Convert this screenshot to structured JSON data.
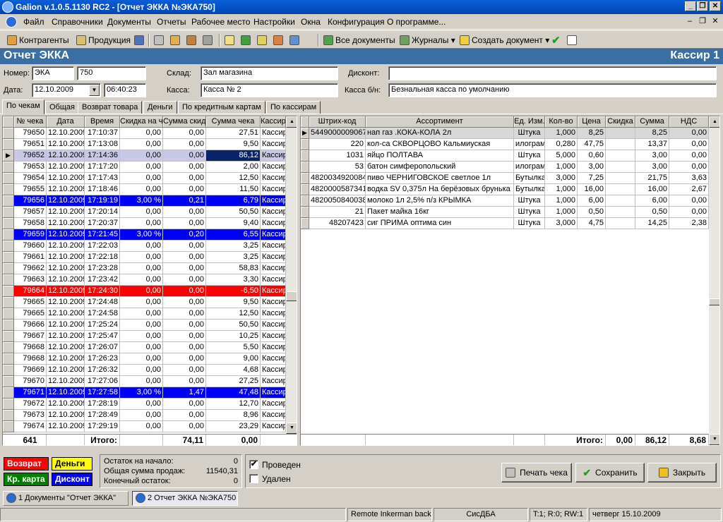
{
  "window": {
    "title": "Galion  v.1.0.5.1130 RC2 - [Отчет ЭККА №ЭКА750]",
    "btn_minimize": "_",
    "btn_restore": "❐",
    "btn_close": "✕"
  },
  "menu": {
    "items": [
      "Файл",
      "Справочники",
      "Документы",
      "Отчеты",
      "Рабочее место",
      "Настройки",
      "Окна",
      "Конфигурация",
      "О программе..."
    ],
    "mdi_min": "–",
    "mdi_restore": "❐",
    "mdi_close": "✕"
  },
  "toolbar": {
    "contractors": "Контрагенты",
    "products": "Продукция",
    "all_docs": "Все документы",
    "journals": "Журналы ▾",
    "create_doc": "Создать документ ▾"
  },
  "header": {
    "title": "Отчет ЭККА",
    "right": "Кассир 1"
  },
  "form": {
    "number_label": "Номер:",
    "number_prefix": "ЭКА",
    "number_value": "750",
    "date_label": "Дата:",
    "date_value": "12.10.2009",
    "time_value": "06:40:23",
    "warehouse_label": "Склад:",
    "warehouse_value": "Зал магазина",
    "kassa_label": "Касса:",
    "kassa_value": "Касса № 2",
    "discount_label": "Дисконт:",
    "discount_value": "",
    "kassa_bn_label": "Касса б/н:",
    "kassa_bn_value": "Безнальная касса по умолчанию",
    "combo_arrow": "▼"
  },
  "tabs": [
    "По чекам",
    "Общая",
    "Возврат товара",
    "Деньги",
    "По кредитным картам",
    "По кассирам"
  ],
  "left_grid": {
    "headers": [
      "№ чека",
      "Дата",
      "Время",
      "Скидка на ч",
      "Сумма скидк",
      "Сумма чека",
      "Кассир"
    ],
    "rows": [
      {
        "n": "79650",
        "d": "12.10.2009",
        "t": "17:10:37",
        "disc": "0,00",
        "dsum": "0,00",
        "sum": "27,51",
        "cash": "Кассир",
        "style": ""
      },
      {
        "n": "79651",
        "d": "12.10.2009",
        "t": "17:13:08",
        "disc": "0,00",
        "dsum": "0,00",
        "sum": "9,50",
        "cash": "Кассир",
        "style": ""
      },
      {
        "n": "79652",
        "d": "12.10.2009",
        "t": "17:14:36",
        "disc": "0,00",
        "dsum": "0,00",
        "sum": "86,12",
        "cash": "Кассир",
        "style": "cur"
      },
      {
        "n": "79653",
        "d": "12.10.2009",
        "t": "17:17:20",
        "disc": "0,00",
        "dsum": "0,00",
        "sum": "2,00",
        "cash": "Кассир",
        "style": ""
      },
      {
        "n": "79654",
        "d": "12.10.2009",
        "t": "17:17:43",
        "disc": "0,00",
        "dsum": "0,00",
        "sum": "12,50",
        "cash": "Кассир",
        "style": ""
      },
      {
        "n": "79655",
        "d": "12.10.2009",
        "t": "17:18:46",
        "disc": "0,00",
        "dsum": "0,00",
        "sum": "11,50",
        "cash": "Кассир",
        "style": ""
      },
      {
        "n": "79656",
        "d": "12.10.2009",
        "t": "17:19:19",
        "disc": "3,00 %",
        "dsum": "0,21",
        "sum": "6,79",
        "cash": "Кассир",
        "style": "blue"
      },
      {
        "n": "79657",
        "d": "12.10.2009",
        "t": "17:20:14",
        "disc": "0,00",
        "dsum": "0,00",
        "sum": "50,50",
        "cash": "Кассир",
        "style": ""
      },
      {
        "n": "79658",
        "d": "12.10.2009",
        "t": "17:20:37",
        "disc": "0,00",
        "dsum": "0,00",
        "sum": "9,40",
        "cash": "Кассир",
        "style": ""
      },
      {
        "n": "79659",
        "d": "12.10.2009",
        "t": "17:21:45",
        "disc": "3,00 %",
        "dsum": "0,20",
        "sum": "6,55",
        "cash": "Кассир",
        "style": "blue"
      },
      {
        "n": "79660",
        "d": "12.10.2009",
        "t": "17:22:03",
        "disc": "0,00",
        "dsum": "0,00",
        "sum": "3,25",
        "cash": "Кассир",
        "style": ""
      },
      {
        "n": "79661",
        "d": "12.10.2009",
        "t": "17:22:18",
        "disc": "0,00",
        "dsum": "0,00",
        "sum": "3,25",
        "cash": "Кассир",
        "style": ""
      },
      {
        "n": "79662",
        "d": "12.10.2009",
        "t": "17:23:28",
        "disc": "0,00",
        "dsum": "0,00",
        "sum": "58,83",
        "cash": "Кассир",
        "style": ""
      },
      {
        "n": "79663",
        "d": "12.10.2009",
        "t": "17:23:42",
        "disc": "0,00",
        "dsum": "0,00",
        "sum": "3,30",
        "cash": "Кассир",
        "style": ""
      },
      {
        "n": "79664",
        "d": "12.10.2009",
        "t": "17:24:30",
        "disc": "0,00",
        "dsum": "0,00",
        "sum": "-6,50",
        "cash": "Кассир",
        "style": "red"
      },
      {
        "n": "79665",
        "d": "12.10.2009",
        "t": "17:24:48",
        "disc": "0,00",
        "dsum": "0,00",
        "sum": "9,50",
        "cash": "Кассир",
        "style": ""
      },
      {
        "n": "79665",
        "d": "12.10.2009",
        "t": "17:24:58",
        "disc": "0,00",
        "dsum": "0,00",
        "sum": "12,50",
        "cash": "Кассир",
        "style": ""
      },
      {
        "n": "79666",
        "d": "12.10.2009",
        "t": "17:25:24",
        "disc": "0,00",
        "dsum": "0,00",
        "sum": "50,50",
        "cash": "Кассир",
        "style": ""
      },
      {
        "n": "79667",
        "d": "12.10.2009",
        "t": "17:25:47",
        "disc": "0,00",
        "dsum": "0,00",
        "sum": "10,25",
        "cash": "Кассир",
        "style": ""
      },
      {
        "n": "79668",
        "d": "12.10.2009",
        "t": "17:26:07",
        "disc": "0,00",
        "dsum": "0,00",
        "sum": "5,50",
        "cash": "Кассир",
        "style": ""
      },
      {
        "n": "79668",
        "d": "12.10.2009",
        "t": "17:26:23",
        "disc": "0,00",
        "dsum": "0,00",
        "sum": "9,00",
        "cash": "Кассир",
        "style": ""
      },
      {
        "n": "79669",
        "d": "12.10.2009",
        "t": "17:26:32",
        "disc": "0,00",
        "dsum": "0,00",
        "sum": "4,68",
        "cash": "Кассир",
        "style": ""
      },
      {
        "n": "79670",
        "d": "12.10.2009",
        "t": "17:27:06",
        "disc": "0,00",
        "dsum": "0,00",
        "sum": "27,25",
        "cash": "Кассир",
        "style": ""
      },
      {
        "n": "79671",
        "d": "12.10.2009",
        "t": "17:27:58",
        "disc": "3,00 %",
        "dsum": "1,47",
        "sum": "47,48",
        "cash": "Кассир",
        "style": "blue"
      },
      {
        "n": "79672",
        "d": "12.10.2009",
        "t": "17:28:19",
        "disc": "0,00",
        "dsum": "0,00",
        "sum": "12,70",
        "cash": "Кассир",
        "style": ""
      },
      {
        "n": "79673",
        "d": "12.10.2009",
        "t": "17:28:49",
        "disc": "0,00",
        "dsum": "0,00",
        "sum": "8,96",
        "cash": "Кассир",
        "style": ""
      },
      {
        "n": "79674",
        "d": "12.10.2009",
        "t": "17:29:19",
        "disc": "0,00",
        "dsum": "0,00",
        "sum": "23,29",
        "cash": "Кассир",
        "style": ""
      }
    ],
    "footer": {
      "count": "641",
      "label": "Итого:",
      "dsum": "74,11",
      "sum": "0,00"
    }
  },
  "right_grid": {
    "headers": [
      "Штрих-код",
      "Ассортимент",
      "Ед. Изм.",
      "Кол-во",
      "Цена",
      "Скидка",
      "Сумма",
      "НДС"
    ],
    "rows": [
      {
        "code": "5449000009067",
        "name": "нап газ .КОКА-КОЛА 2л",
        "unit": "Штука",
        "qty": "1,000",
        "price": "8,25",
        "disc": "",
        "sum": "8,25",
        "vat": "0,00",
        "style": "grey"
      },
      {
        "code": "220",
        "name": "кол-са СКВОРЦОВО Кальмиуская",
        "unit": "илограм",
        "qty": "0,280",
        "price": "47,75",
        "disc": "",
        "sum": "13,37",
        "vat": "0,00",
        "style": ""
      },
      {
        "code": "1031",
        "name": "яйцо ПОЛТАВА",
        "unit": "Штука",
        "qty": "5,000",
        "price": "0,60",
        "disc": "",
        "sum": "3,00",
        "vat": "0,00",
        "style": ""
      },
      {
        "code": "53",
        "name": "батон симферопольский",
        "unit": "илограм",
        "qty": "1,000",
        "price": "3,00",
        "disc": "",
        "sum": "3,00",
        "vat": "0,00",
        "style": ""
      },
      {
        "code": "4820034920084",
        "name": "пиво ЧЕРНИГОВСКОЕ светлое 1л",
        "unit": "Бутылка",
        "qty": "3,000",
        "price": "7,25",
        "disc": "",
        "sum": "21,75",
        "vat": "3,63",
        "style": ""
      },
      {
        "code": "4820000587341",
        "name": "водка SV 0,375л На берёзовых брунька",
        "unit": "Бутылка",
        "qty": "1,000",
        "price": "16,00",
        "disc": "",
        "sum": "16,00",
        "vat": "2,67",
        "style": ""
      },
      {
        "code": "4820050840038",
        "name": "молоко 1л 2,5% п/з КРЫМКА",
        "unit": "Штука",
        "qty": "1,000",
        "price": "6,00",
        "disc": "",
        "sum": "6,00",
        "vat": "0,00",
        "style": ""
      },
      {
        "code": "21",
        "name": "Пакет майка 16кг",
        "unit": "Штука",
        "qty": "1,000",
        "price": "0,50",
        "disc": "",
        "sum": "0,50",
        "vat": "0,00",
        "style": ""
      },
      {
        "code": "48207423",
        "name": "сиг ПРИМА оптима син",
        "unit": "Штука",
        "qty": "3,000",
        "price": "4,75",
        "disc": "",
        "sum": "14,25",
        "vat": "2,38",
        "style": ""
      }
    ],
    "footer": {
      "label": "Итого:",
      "disc": "0,00",
      "sum": "86,12",
      "vat": "8,68"
    }
  },
  "legend": {
    "return": "Возврат",
    "money": "Деньги",
    "card": "Кр. карта",
    "discount": "Дисконт"
  },
  "summary": {
    "start_label": "Остаток на начало:",
    "start_value": "0",
    "sales_label": "Общая сумма продаж:",
    "sales_value": "11540,31",
    "end_label": "Конечный остаток:",
    "end_value": "0"
  },
  "checks": {
    "posted_label": "Проведен",
    "posted_mark": "✔",
    "deleted_label": "Удален"
  },
  "buttons": {
    "print": "Печать чека",
    "save": "Сохранить",
    "close": "Закрыть"
  },
  "taskbar": {
    "item1": "1 Документы \"Отчет ЭККА\"",
    "item2": "2 Отчет ЭККА №ЭКА750"
  },
  "status": {
    "s1": "",
    "s2": "Remote Inkerman backup",
    "s3": "СисДБА",
    "s4": "T:1; R:0; RW:1",
    "s5": "четверг 15.10.2009"
  },
  "colors": {
    "header_band": "#3a6ea5",
    "row_blue": "#0000ff",
    "row_red": "#ff0000",
    "legend_return": "#ff0000",
    "legend_money": "#ffff00",
    "legend_card": "#008000",
    "legend_discount": "#0000ff"
  }
}
